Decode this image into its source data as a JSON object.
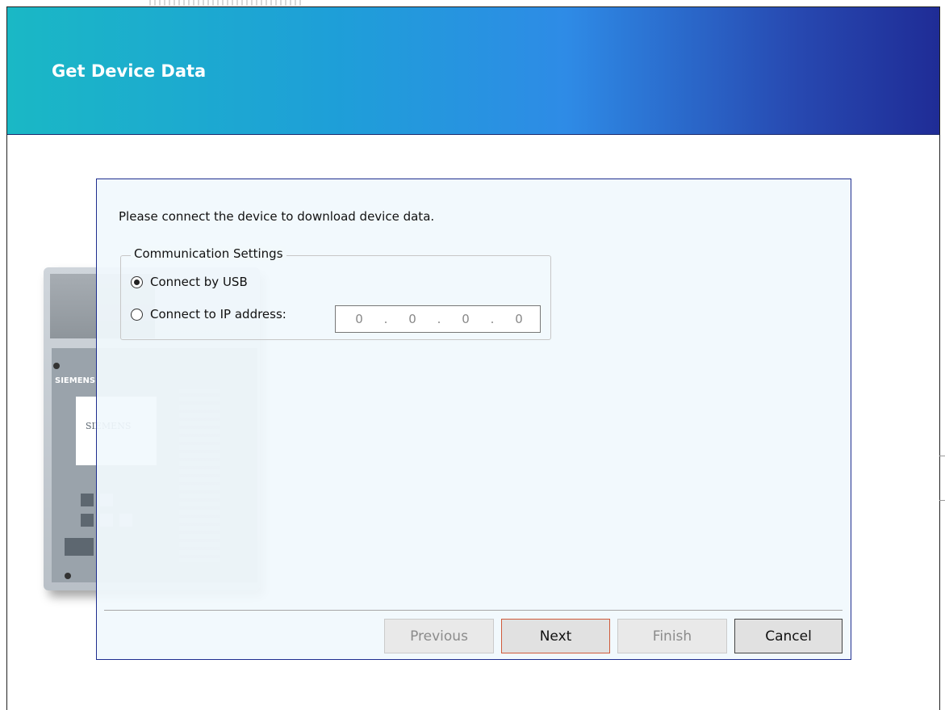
{
  "header": {
    "title": "Get Device Data"
  },
  "device": {
    "brand_label": "SIEMENS",
    "screen_brand": "SIEMENS"
  },
  "panel": {
    "prompt": "Please connect the device to download device data.",
    "communication": {
      "legend": "Communication Settings",
      "options": [
        {
          "label": "Connect by USB",
          "selected": true
        },
        {
          "label": "Connect to IP address:",
          "selected": false
        }
      ],
      "ip_octets": [
        "0",
        "0",
        "0",
        "0"
      ],
      "ip_separator": "."
    }
  },
  "buttons": {
    "previous": "Previous",
    "next": "Next",
    "finish": "Finish",
    "cancel": "Cancel"
  },
  "colors": {
    "header_start": "#1ab8c5",
    "header_end": "#1f2c96",
    "panel_border": "#1f2e8f",
    "next_border": "#d05a3a"
  }
}
